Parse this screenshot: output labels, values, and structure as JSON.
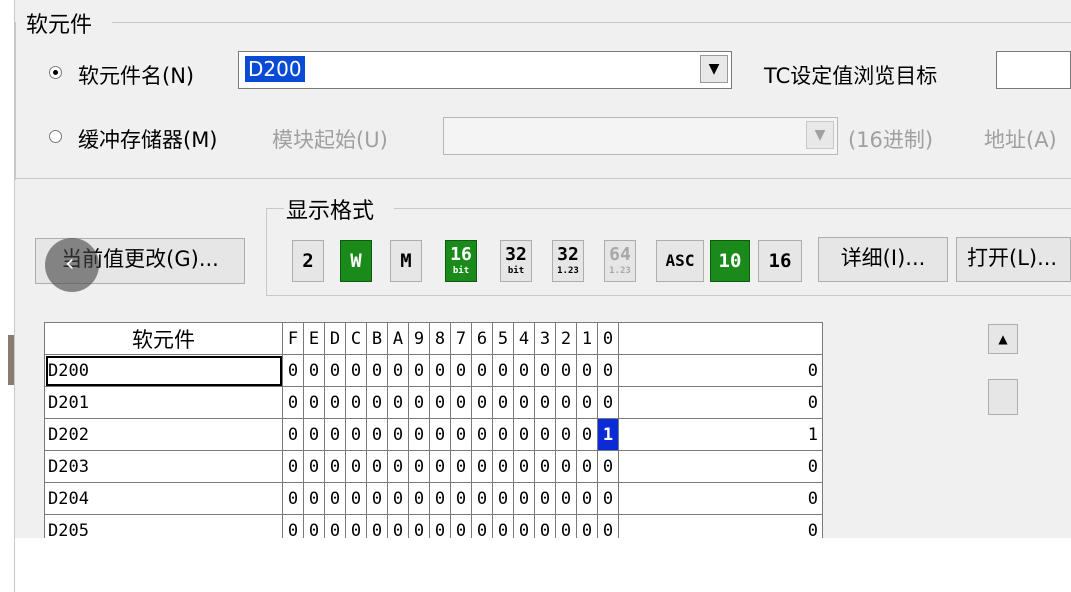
{
  "device_group": {
    "title": "软元件",
    "radio_device_name": {
      "label": "软元件名(N)",
      "checked": true
    },
    "device_name_value": "D200",
    "tc_label": "TC设定值浏览目标",
    "radio_buffer_memory": {
      "label": "缓冲存储器(M)",
      "checked": false
    },
    "module_start_label": "模块起始(U)",
    "hex_label": "(16进制)",
    "address_label": "地址(A)"
  },
  "change_value_button": "当前值更改(G)...",
  "display_format": {
    "title": "显示格式",
    "buttons": [
      {
        "name": "bit-2",
        "text": "2"
      },
      {
        "name": "word",
        "text": "W"
      },
      {
        "name": "double-word",
        "text": "M"
      },
      {
        "name": "16bit",
        "top": "16",
        "bottom": "bit"
      },
      {
        "name": "32bit",
        "top": "32",
        "bottom": "bit"
      },
      {
        "name": "32-float",
        "top": "32",
        "bottom": "1.23"
      },
      {
        "name": "64-float",
        "top": "64",
        "bottom": "1.23"
      },
      {
        "name": "ascii",
        "text": "ASC"
      },
      {
        "name": "dec-10",
        "text": "10"
      },
      {
        "name": "hex-16",
        "text": "16"
      }
    ],
    "detail_button": "详细(I)...",
    "open_button": "打开(L)..."
  },
  "table": {
    "device_header": "软元件",
    "bit_headers": [
      "F",
      "E",
      "D",
      "C",
      "B",
      "A",
      "9",
      "8",
      "7",
      "6",
      "5",
      "4",
      "3",
      "2",
      "1",
      "0"
    ],
    "rows": [
      {
        "device": "D200",
        "bits": [
          "0",
          "0",
          "0",
          "0",
          "0",
          "0",
          "0",
          "0",
          "0",
          "0",
          "0",
          "0",
          "0",
          "0",
          "0",
          "0"
        ],
        "value": "0"
      },
      {
        "device": "D201",
        "bits": [
          "0",
          "0",
          "0",
          "0",
          "0",
          "0",
          "0",
          "0",
          "0",
          "0",
          "0",
          "0",
          "0",
          "0",
          "0",
          "0"
        ],
        "value": "0"
      },
      {
        "device": "D202",
        "bits": [
          "0",
          "0",
          "0",
          "0",
          "0",
          "0",
          "0",
          "0",
          "0",
          "0",
          "0",
          "0",
          "0",
          "0",
          "0",
          "1"
        ],
        "value": "1"
      },
      {
        "device": "D203",
        "bits": [
          "0",
          "0",
          "0",
          "0",
          "0",
          "0",
          "0",
          "0",
          "0",
          "0",
          "0",
          "0",
          "0",
          "0",
          "0",
          "0"
        ],
        "value": "0"
      },
      {
        "device": "D204",
        "bits": [
          "0",
          "0",
          "0",
          "0",
          "0",
          "0",
          "0",
          "0",
          "0",
          "0",
          "0",
          "0",
          "0",
          "0",
          "0",
          "0"
        ],
        "value": "0"
      },
      {
        "device": "D205",
        "bits": [
          "0",
          "0",
          "0",
          "0",
          "0",
          "0",
          "0",
          "0",
          "0",
          "0",
          "0",
          "0",
          "0",
          "0",
          "0",
          "0"
        ],
        "value": "0"
      }
    ],
    "highlight": {
      "row": 2,
      "bit": 15
    }
  },
  "colors": {
    "highlight": "#0a2bd6",
    "format_active": "#1a8a1a",
    "selection": "#0a4bd6"
  },
  "icons": {
    "back": "chevron-left-icon",
    "scroll_up": "scroll-up-arrow-icon",
    "dropdown": "dropdown-arrow-icon"
  }
}
